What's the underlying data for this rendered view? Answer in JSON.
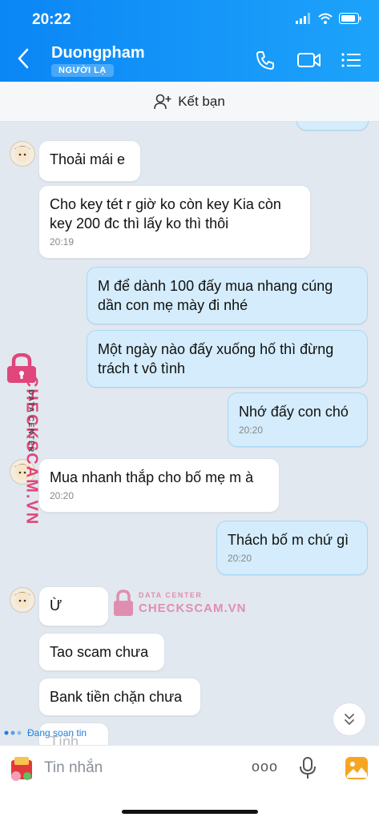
{
  "status_bar": {
    "time": "20:22"
  },
  "header": {
    "name": "Duongpham",
    "badge": "NGƯỜI LẠ"
  },
  "add_friend": {
    "label": "Kết bạn"
  },
  "messages": [
    {
      "text": "Thoải mái e",
      "time": ""
    },
    {
      "text": "Cho key tét r giờ ko còn key Kia còn key 200 đc thì lấy ko thì thôi",
      "time": "20:19"
    },
    {
      "text": "M để dành 100 đấy mua nhang cúng dần con mẹ mày đi nhé",
      "time": ""
    },
    {
      "text": "Một ngày nào đấy xuống hố thì đừng trách t vô tình",
      "time": ""
    },
    {
      "text": "Nhớ đấy con chó",
      "time": "20:20"
    },
    {
      "text": "Mua nhanh thắp cho bố mẹ m à",
      "time": "20:20"
    },
    {
      "text": "Thách bố m chứ gì",
      "time": "20:20"
    },
    {
      "text": "Ừ",
      "time": ""
    },
    {
      "text": "Tao scam chưa",
      "time": ""
    },
    {
      "text": "Bank tiền chặn chưa",
      "time": ""
    },
    {
      "text": "Tình",
      "time": ""
    }
  ],
  "watermark": {
    "line1": "DATA CENTER",
    "line2": "CHECKSCAM.VN"
  },
  "typing_indicator": "Đang soạn tin",
  "composer": {
    "placeholder": "Tin nhắn",
    "more": "ooo"
  },
  "colors": {
    "header": "#0b86f5",
    "outgoing": "#d4ecfb",
    "watermark": "#e0457b"
  }
}
